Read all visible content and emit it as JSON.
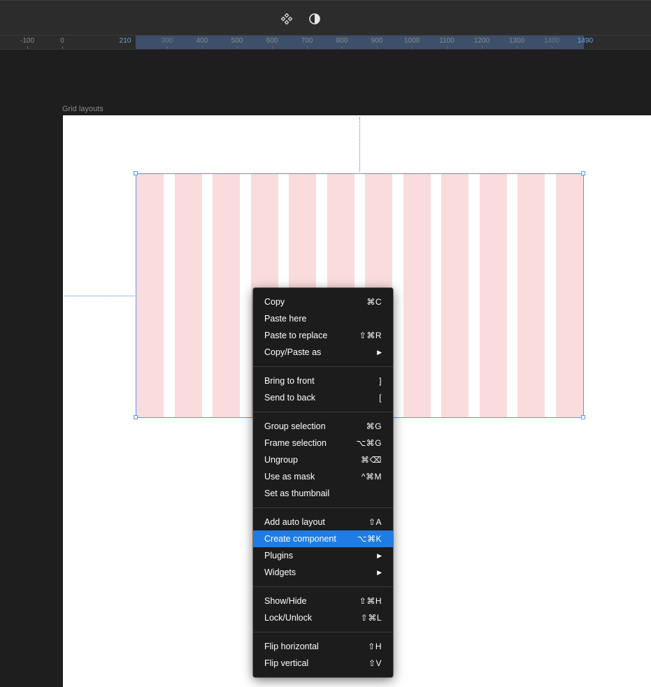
{
  "toolbar": {
    "icons": [
      "component-icon",
      "contrast-icon"
    ]
  },
  "ruler": {
    "ticks": [
      {
        "label": "-100",
        "value": -100,
        "kind": "normal"
      },
      {
        "label": "0",
        "value": 0,
        "kind": "normal"
      },
      {
        "label": "210",
        "value": 210,
        "kind": "accent"
      },
      {
        "label": "300",
        "value": 300,
        "kind": "dim"
      },
      {
        "label": "400",
        "value": 400,
        "kind": "normal"
      },
      {
        "label": "500",
        "value": 500,
        "kind": "normal"
      },
      {
        "label": "600",
        "value": 600,
        "kind": "normal"
      },
      {
        "label": "700",
        "value": 700,
        "kind": "normal"
      },
      {
        "label": "800",
        "value": 800,
        "kind": "normal"
      },
      {
        "label": "900",
        "value": 900,
        "kind": "normal"
      },
      {
        "label": "1000",
        "value": 1000,
        "kind": "normal"
      },
      {
        "label": "1100",
        "value": 1100,
        "kind": "normal"
      },
      {
        "label": "1200",
        "value": 1200,
        "kind": "normal"
      },
      {
        "label": "1300",
        "value": 1300,
        "kind": "normal"
      },
      {
        "label": "1400",
        "value": 1400,
        "kind": "dim"
      },
      {
        "label": "1490",
        "value": 1490,
        "kind": "accent"
      }
    ]
  },
  "frame": {
    "label": "Grid layouts",
    "grid_columns": 12
  },
  "colors": {
    "selection": "#4d9bf0",
    "grid_column": "#fadcdc",
    "menu_bg": "#1c1c1c",
    "menu_highlight": "#1e7ce4"
  },
  "menu": {
    "groups": [
      [
        {
          "label": "Copy",
          "shortcut": "⌘C"
        },
        {
          "label": "Paste here",
          "shortcut": ""
        },
        {
          "label": "Paste to replace",
          "shortcut": "⇧⌘R"
        },
        {
          "label": "Copy/Paste as",
          "shortcut": "",
          "submenu": true
        }
      ],
      [
        {
          "label": "Bring to front",
          "shortcut": "]"
        },
        {
          "label": "Send to back",
          "shortcut": "["
        }
      ],
      [
        {
          "label": "Group selection",
          "shortcut": "⌘G"
        },
        {
          "label": "Frame selection",
          "shortcut": "⌥⌘G"
        },
        {
          "label": "Ungroup",
          "shortcut": "⌘⌫"
        },
        {
          "label": "Use as mask",
          "shortcut": "^⌘M"
        },
        {
          "label": "Set as thumbnail",
          "shortcut": ""
        }
      ],
      [
        {
          "label": "Add auto layout",
          "shortcut": "⇧A"
        },
        {
          "label": "Create component",
          "shortcut": "⌥⌘K",
          "active": true
        },
        {
          "label": "Plugins",
          "shortcut": "",
          "submenu": true
        },
        {
          "label": "Widgets",
          "shortcut": "",
          "submenu": true
        }
      ],
      [
        {
          "label": "Show/Hide",
          "shortcut": "⇧⌘H"
        },
        {
          "label": "Lock/Unlock",
          "shortcut": "⇧⌘L"
        }
      ],
      [
        {
          "label": "Flip horizontal",
          "shortcut": "⇧H"
        },
        {
          "label": "Flip vertical",
          "shortcut": "⇧V"
        }
      ]
    ]
  }
}
